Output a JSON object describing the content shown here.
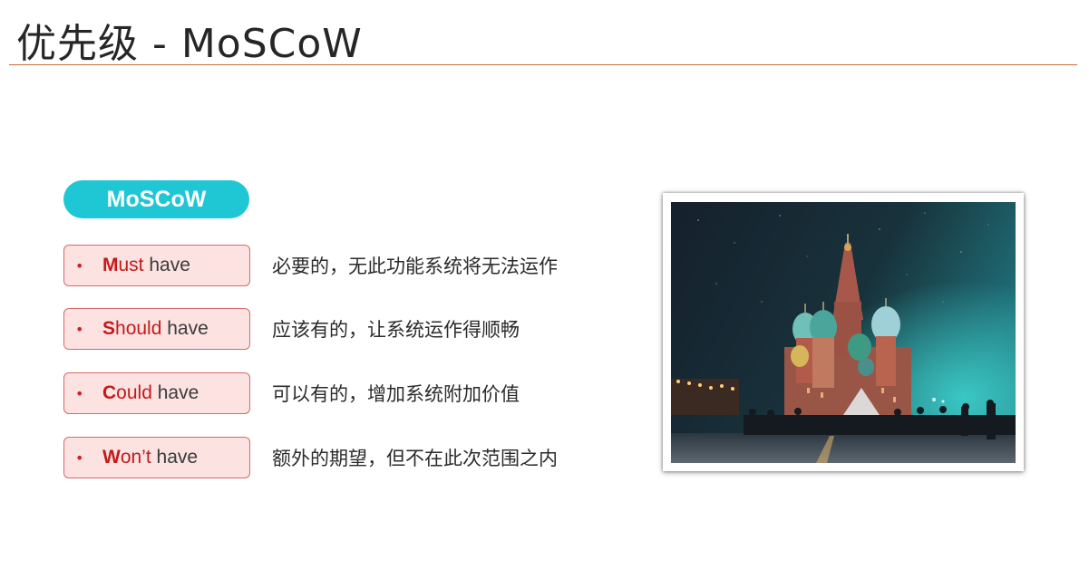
{
  "title": "优先级 - MoSCoW",
  "pill_label": "MoSCoW",
  "items": [
    {
      "first": "M",
      "red_rest": "ust",
      "rest": " have",
      "desc": "必要的，无此功能系统将无法运作"
    },
    {
      "first": "S",
      "red_rest": "hould",
      "rest": " have",
      "desc": "应该有的，让系统运作得顺畅"
    },
    {
      "first": "C",
      "red_rest": "ould",
      "rest": " have",
      "desc": "可以有的，增加系统附加价值"
    },
    {
      "first": "W",
      "red_rest": "on’t",
      "rest": " have",
      "desc": "额外的期望，但不在此次范围之内"
    }
  ],
  "bullet": "•",
  "colors": {
    "accent": "#1fc7d4",
    "rule": "#c9683a",
    "red": "#c21b1b",
    "box_bg": "#fde2e2"
  },
  "photo_subject": "St. Basil's Cathedral at night"
}
